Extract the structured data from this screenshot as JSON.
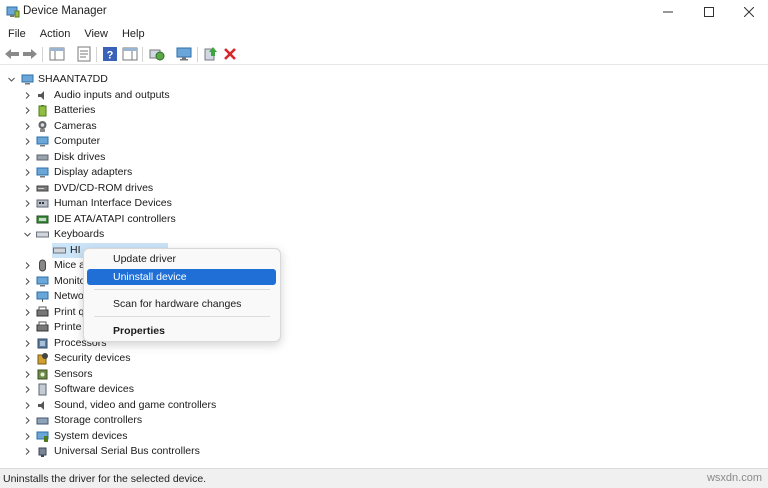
{
  "window": {
    "title": "Device Manager"
  },
  "menu": [
    "File",
    "Action",
    "View",
    "Help"
  ],
  "toolbar": {
    "icons": [
      "back-arrow-icon",
      "forward-arrow-icon",
      "show-hide-console-tree-icon",
      "properties-icon",
      "help-icon",
      "scan-hardware-changes-icon",
      "monitor-icon",
      "update-driver-icon",
      "uninstall-device-icon"
    ]
  },
  "tree": {
    "root": "SHAANTA7DD",
    "categories": [
      "Audio inputs and outputs",
      "Batteries",
      "Cameras",
      "Computer",
      "Disk drives",
      "Display adapters",
      "DVD/CD-ROM drives",
      "Human Interface Devices",
      "IDE ATA/ATAPI controllers",
      "Keyboards",
      "HI",
      "Mice a",
      "Monito",
      "Netwo",
      "Print q",
      "Printe",
      "Processors",
      "Security devices",
      "Sensors",
      "Software devices",
      "Sound, video and game controllers",
      "Storage controllers",
      "System devices",
      "Universal Serial Bus controllers"
    ]
  },
  "context_menu": {
    "update_driver": "Update driver",
    "uninstall_device": "Uninstall device",
    "scan_hardware": "Scan for hardware changes",
    "properties": "Properties"
  },
  "status": {
    "text": "Uninstalls the driver for the selected device.",
    "watermark": "wsxdn.com"
  },
  "colors": {
    "accent": "#1f6fd6",
    "selection": "#cce4f7"
  }
}
